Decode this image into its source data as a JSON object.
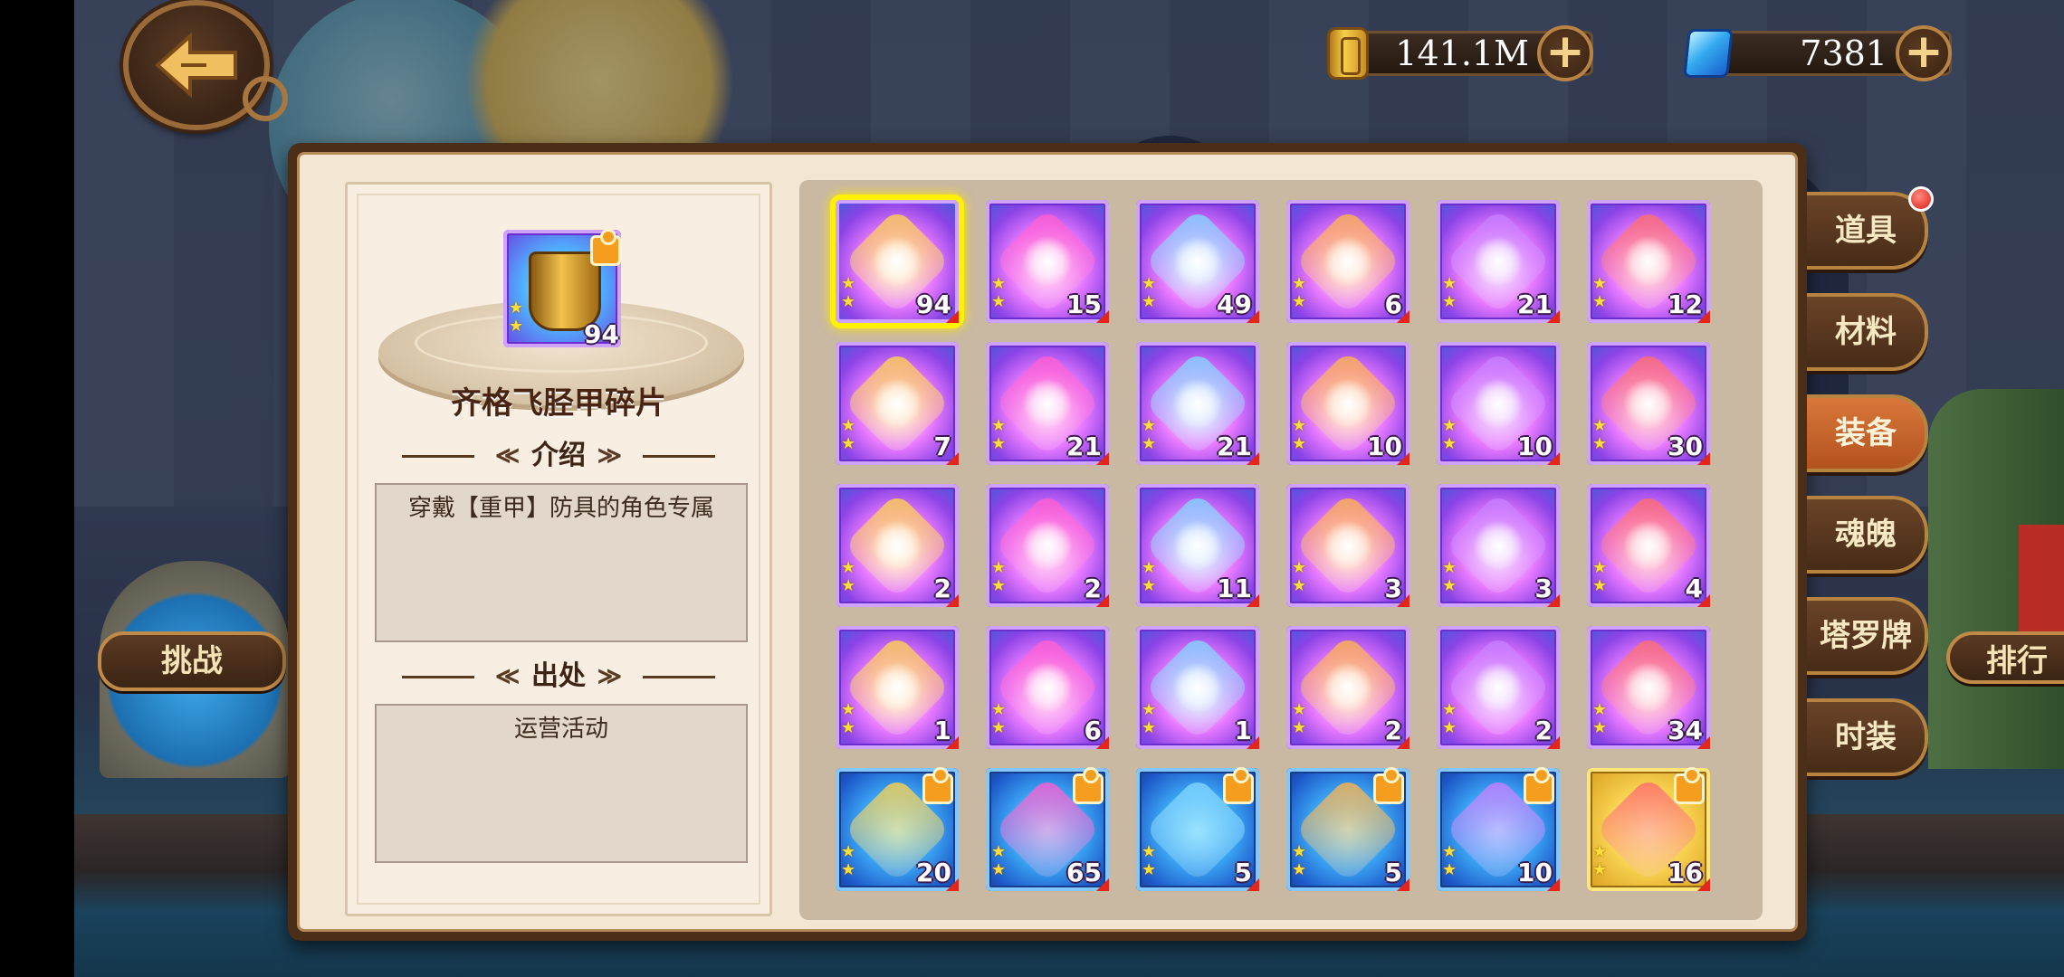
{
  "currency": {
    "gold_amount": "141.1M",
    "gem_amount": "7381",
    "plus_symbol": "+"
  },
  "side": {
    "challenge_label": "挑战",
    "rank_label": "排行"
  },
  "selected_item": {
    "name": "齐格飞胫甲碎片",
    "quantity": "94",
    "intro_heading": "介绍",
    "intro_text": "穿戴【重甲】防具的角色专属",
    "source_heading": "出处",
    "source_text": "运营活动"
  },
  "grid_items": [
    {
      "qty": "94",
      "type": "epic",
      "selected": true
    },
    {
      "qty": "15",
      "type": "epic"
    },
    {
      "qty": "49",
      "type": "epic"
    },
    {
      "qty": "6",
      "type": "epic"
    },
    {
      "qty": "21",
      "type": "epic"
    },
    {
      "qty": "12",
      "type": "epic"
    },
    {
      "qty": "7",
      "type": "epic"
    },
    {
      "qty": "21",
      "type": "epic"
    },
    {
      "qty": "21",
      "type": "epic"
    },
    {
      "qty": "10",
      "type": "epic"
    },
    {
      "qty": "10",
      "type": "epic"
    },
    {
      "qty": "30",
      "type": "epic"
    },
    {
      "qty": "2",
      "type": "epic"
    },
    {
      "qty": "2",
      "type": "epic"
    },
    {
      "qty": "11",
      "type": "epic"
    },
    {
      "qty": "3",
      "type": "epic"
    },
    {
      "qty": "3",
      "type": "epic"
    },
    {
      "qty": "4",
      "type": "epic"
    },
    {
      "qty": "1",
      "type": "epic"
    },
    {
      "qty": "6",
      "type": "epic"
    },
    {
      "qty": "1",
      "type": "epic"
    },
    {
      "qty": "2",
      "type": "epic"
    },
    {
      "qty": "2",
      "type": "epic"
    },
    {
      "qty": "34",
      "type": "epic"
    },
    {
      "qty": "20",
      "type": "rare"
    },
    {
      "qty": "65",
      "type": "rare"
    },
    {
      "qty": "5",
      "type": "rare"
    },
    {
      "qty": "5",
      "type": "rare"
    },
    {
      "qty": "10",
      "type": "rare"
    },
    {
      "qty": "16",
      "type": "gold"
    }
  ],
  "tabs": [
    {
      "label": "道具",
      "active": false,
      "badge": true
    },
    {
      "label": "材料",
      "active": false
    },
    {
      "label": "装备",
      "active": true
    },
    {
      "label": "魂魄",
      "active": false
    },
    {
      "label": "塔罗牌",
      "active": false
    },
    {
      "label": "时装",
      "active": false
    }
  ],
  "colors": {
    "panel_bg": "#f3e6d3",
    "active_tab": "#d9773a",
    "selected_outline": "#fff200"
  },
  "icons": {
    "back": "back-arrow-icon",
    "gold": "gold-coin-icon",
    "gem": "blue-gem-icon",
    "add": "plus-icon",
    "fragment": "puzzle-piece-icon",
    "star": "star-icon",
    "notification": "red-dot-icon"
  }
}
